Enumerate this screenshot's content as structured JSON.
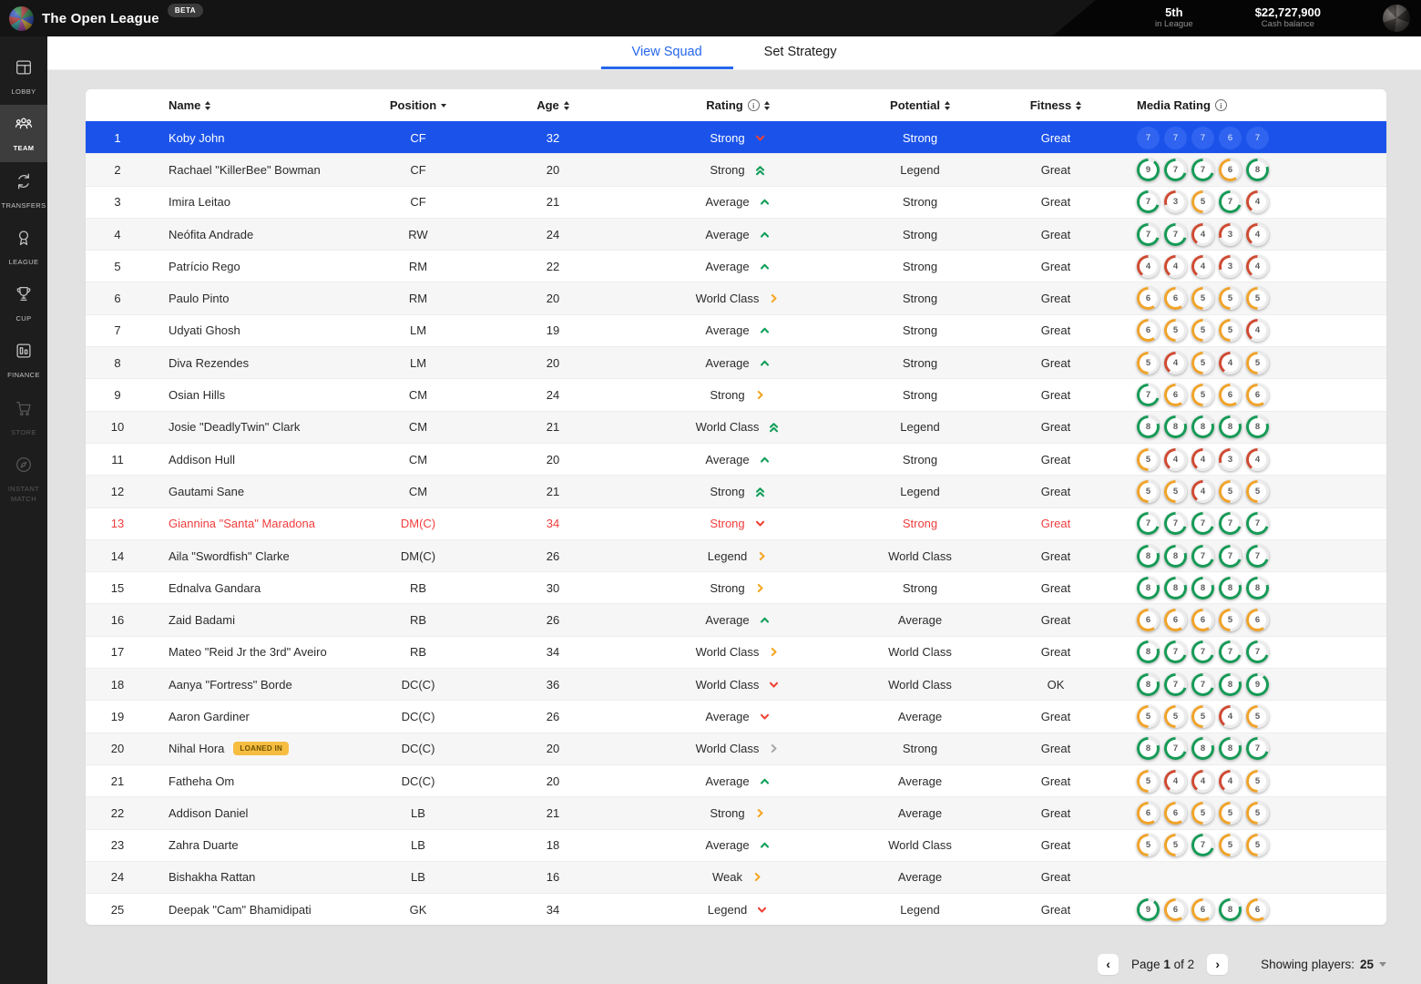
{
  "app": {
    "title": "The Open League",
    "beta_badge": "BETA"
  },
  "topbar": {
    "league_position": "5th",
    "league_position_label": "in League",
    "cash_balance": "$22,727,900",
    "cash_balance_label": "Cash balance"
  },
  "sidebar": {
    "items": [
      {
        "id": "lobby",
        "label": "LOBBY",
        "active": false,
        "dimmed": false
      },
      {
        "id": "team",
        "label": "TEAM",
        "active": true,
        "dimmed": false
      },
      {
        "id": "transfers",
        "label": "TRANSFERS",
        "active": false,
        "dimmed": false
      },
      {
        "id": "league",
        "label": "LEAGUE",
        "active": false,
        "dimmed": false
      },
      {
        "id": "cup",
        "label": "CUP",
        "active": false,
        "dimmed": false
      },
      {
        "id": "finance",
        "label": "FINANCE",
        "active": false,
        "dimmed": false
      },
      {
        "id": "store",
        "label": "STORE",
        "active": false,
        "dimmed": true
      },
      {
        "id": "instant-match",
        "label": "INSTANT MATCH",
        "active": false,
        "dimmed": true
      }
    ]
  },
  "tabs": [
    {
      "label": "View Squad",
      "active": true
    },
    {
      "label": "Set Strategy",
      "active": false
    }
  ],
  "table": {
    "headers": {
      "name": "Name",
      "position": "Position",
      "age": "Age",
      "rating": "Rating",
      "potential": "Potential",
      "fitness": "Fitness",
      "media_rating": "Media Rating"
    },
    "rows": [
      {
        "num": "1",
        "name": "Koby John",
        "position": "CF",
        "age": "32",
        "rating": "Strong",
        "trend": "down",
        "trend_color": "red",
        "potential": "Strong",
        "fitness": "Great",
        "media": [
          7,
          7,
          7,
          6,
          7
        ],
        "selected": true
      },
      {
        "num": "2",
        "name": "Rachael \"KillerBee\" Bowman",
        "position": "CF",
        "age": "20",
        "rating": "Strong",
        "trend": "double-up",
        "trend_color": "green",
        "potential": "Legend",
        "fitness": "Great",
        "media": [
          9,
          7,
          7,
          6,
          8
        ]
      },
      {
        "num": "3",
        "name": "Imira Leitao",
        "position": "CF",
        "age": "21",
        "rating": "Average",
        "trend": "up",
        "trend_color": "green",
        "potential": "Strong",
        "fitness": "Great",
        "media": [
          7,
          3,
          5,
          7,
          4
        ]
      },
      {
        "num": "4",
        "name": "Neófita Andrade",
        "position": "RW",
        "age": "24",
        "rating": "Average",
        "trend": "up",
        "trend_color": "green",
        "potential": "Strong",
        "fitness": "Great",
        "media": [
          7,
          7,
          4,
          3,
          4
        ]
      },
      {
        "num": "5",
        "name": "Patrício Rego",
        "position": "RM",
        "age": "22",
        "rating": "Average",
        "trend": "up",
        "trend_color": "green",
        "potential": "Strong",
        "fitness": "Great",
        "media": [
          4,
          4,
          4,
          3,
          4
        ]
      },
      {
        "num": "6",
        "name": "Paulo Pinto",
        "position": "RM",
        "age": "20",
        "rating": "World Class",
        "trend": "right",
        "trend_color": "orange",
        "potential": "Strong",
        "fitness": "Great",
        "media": [
          6,
          6,
          5,
          5,
          5
        ]
      },
      {
        "num": "7",
        "name": "Udyati Ghosh",
        "position": "LM",
        "age": "19",
        "rating": "Average",
        "trend": "up",
        "trend_color": "green",
        "potential": "Strong",
        "fitness": "Great",
        "media": [
          6,
          5,
          5,
          5,
          4
        ]
      },
      {
        "num": "8",
        "name": "Diva Rezendes",
        "position": "LM",
        "age": "20",
        "rating": "Average",
        "trend": "up",
        "trend_color": "green",
        "potential": "Strong",
        "fitness": "Great",
        "media": [
          5,
          4,
          5,
          4,
          5
        ]
      },
      {
        "num": "9",
        "name": "Osian Hills",
        "position": "CM",
        "age": "24",
        "rating": "Strong",
        "trend": "right",
        "trend_color": "orange",
        "potential": "Strong",
        "fitness": "Great",
        "media": [
          7,
          6,
          5,
          6,
          6
        ]
      },
      {
        "num": "10",
        "name": "Josie \"DeadlyTwin\" Clark",
        "position": "CM",
        "age": "21",
        "rating": "World Class",
        "trend": "double-up",
        "trend_color": "green",
        "potential": "Legend",
        "fitness": "Great",
        "media": [
          8,
          8,
          8,
          8,
          8
        ]
      },
      {
        "num": "11",
        "name": "Addison Hull",
        "position": "CM",
        "age": "20",
        "rating": "Average",
        "trend": "up",
        "trend_color": "green",
        "potential": "Strong",
        "fitness": "Great",
        "media": [
          5,
          4,
          4,
          3,
          4
        ]
      },
      {
        "num": "12",
        "name": "Gautami Sane",
        "position": "CM",
        "age": "21",
        "rating": "Strong",
        "trend": "double-up",
        "trend_color": "green",
        "potential": "Legend",
        "fitness": "Great",
        "media": [
          5,
          5,
          4,
          5,
          5
        ]
      },
      {
        "num": "13",
        "name": "Giannina \"Santa\" Maradona",
        "position": "DM(C)",
        "age": "34",
        "rating": "Strong",
        "trend": "down",
        "trend_color": "red",
        "potential": "Strong",
        "fitness": "Great",
        "media": [
          7,
          7,
          7,
          7,
          7
        ],
        "alert": true
      },
      {
        "num": "14",
        "name": "Aila \"Swordfish\" Clarke",
        "position": "DM(C)",
        "age": "26",
        "rating": "Legend",
        "trend": "right",
        "trend_color": "orange",
        "potential": "World Class",
        "fitness": "Great",
        "media": [
          8,
          8,
          7,
          7,
          7
        ]
      },
      {
        "num": "15",
        "name": "Ednalva Gandara",
        "position": "RB",
        "age": "30",
        "rating": "Strong",
        "trend": "right",
        "trend_color": "orange",
        "potential": "Strong",
        "fitness": "Great",
        "media": [
          8,
          8,
          8,
          8,
          8
        ]
      },
      {
        "num": "16",
        "name": "Zaid Badami",
        "position": "RB",
        "age": "26",
        "rating": "Average",
        "trend": "up",
        "trend_color": "green",
        "potential": "Average",
        "fitness": "Great",
        "media": [
          6,
          6,
          6,
          5,
          6
        ]
      },
      {
        "num": "17",
        "name": "Mateo \"Reid Jr the 3rd\" Aveiro",
        "position": "RB",
        "age": "34",
        "rating": "World Class",
        "trend": "right",
        "trend_color": "orange",
        "potential": "World Class",
        "fitness": "Great",
        "media": [
          8,
          7,
          7,
          7,
          7
        ]
      },
      {
        "num": "18",
        "name": "Aanya \"Fortress\" Borde",
        "position": "DC(C)",
        "age": "36",
        "rating": "World Class",
        "trend": "down",
        "trend_color": "red",
        "potential": "World Class",
        "fitness": "OK",
        "media": [
          8,
          7,
          7,
          8,
          9
        ]
      },
      {
        "num": "19",
        "name": "Aaron Gardiner",
        "position": "DC(C)",
        "age": "26",
        "rating": "Average",
        "trend": "down",
        "trend_color": "red",
        "potential": "Average",
        "fitness": "Great",
        "media": [
          5,
          5,
          5,
          4,
          5
        ]
      },
      {
        "num": "20",
        "name": "Nihal Hora",
        "badge": "LOANED IN",
        "position": "DC(C)",
        "age": "20",
        "rating": "World Class",
        "trend": "right",
        "trend_color": "gray",
        "potential": "Strong",
        "fitness": "Great",
        "media": [
          8,
          7,
          8,
          8,
          7
        ]
      },
      {
        "num": "21",
        "name": "Fatheha Om",
        "position": "DC(C)",
        "age": "20",
        "rating": "Average",
        "trend": "up",
        "trend_color": "green",
        "potential": "Average",
        "fitness": "Great",
        "media": [
          5,
          4,
          4,
          4,
          5
        ]
      },
      {
        "num": "22",
        "name": "Addison Daniel",
        "position": "LB",
        "age": "21",
        "rating": "Strong",
        "trend": "right",
        "trend_color": "orange",
        "potential": "Average",
        "fitness": "Great",
        "media": [
          6,
          6,
          5,
          5,
          5
        ]
      },
      {
        "num": "23",
        "name": "Zahra Duarte",
        "position": "LB",
        "age": "18",
        "rating": "Average",
        "trend": "up",
        "trend_color": "green",
        "potential": "World Class",
        "fitness": "Great",
        "media": [
          5,
          5,
          7,
          5,
          5
        ]
      },
      {
        "num": "24",
        "name": "Bishakha Rattan",
        "position": "LB",
        "age": "16",
        "rating": "Weak",
        "trend": "right",
        "trend_color": "orange",
        "potential": "Average",
        "fitness": "Great",
        "media": []
      },
      {
        "num": "25",
        "name": "Deepak \"Cam\" Bhamidipati",
        "position": "GK",
        "age": "34",
        "rating": "Legend",
        "trend": "down",
        "trend_color": "red",
        "potential": "Legend",
        "fitness": "Great",
        "media": [
          9,
          6,
          6,
          8,
          6
        ]
      }
    ]
  },
  "footer": {
    "prev": "‹",
    "next": "›",
    "page_label": "Page",
    "page_current": "1",
    "page_rest": "of 2",
    "showing_label": "Showing players:",
    "showing_value": "25"
  },
  "colors": {
    "accent_blue": "#1b53ea",
    "tab_blue": "#2667ee",
    "trend_green": "#0f9e58",
    "trend_orange": "#f5a623",
    "trend_red": "#ef4136",
    "trend_gray": "#a9a9a9",
    "alert_red": "#f23d3d",
    "arc_green": "#169a56",
    "arc_orange": "#f0a32a",
    "arc_red": "#cf4a32",
    "arc_rest": "#ececec",
    "loaned_badge_bg": "#f6bd41"
  }
}
